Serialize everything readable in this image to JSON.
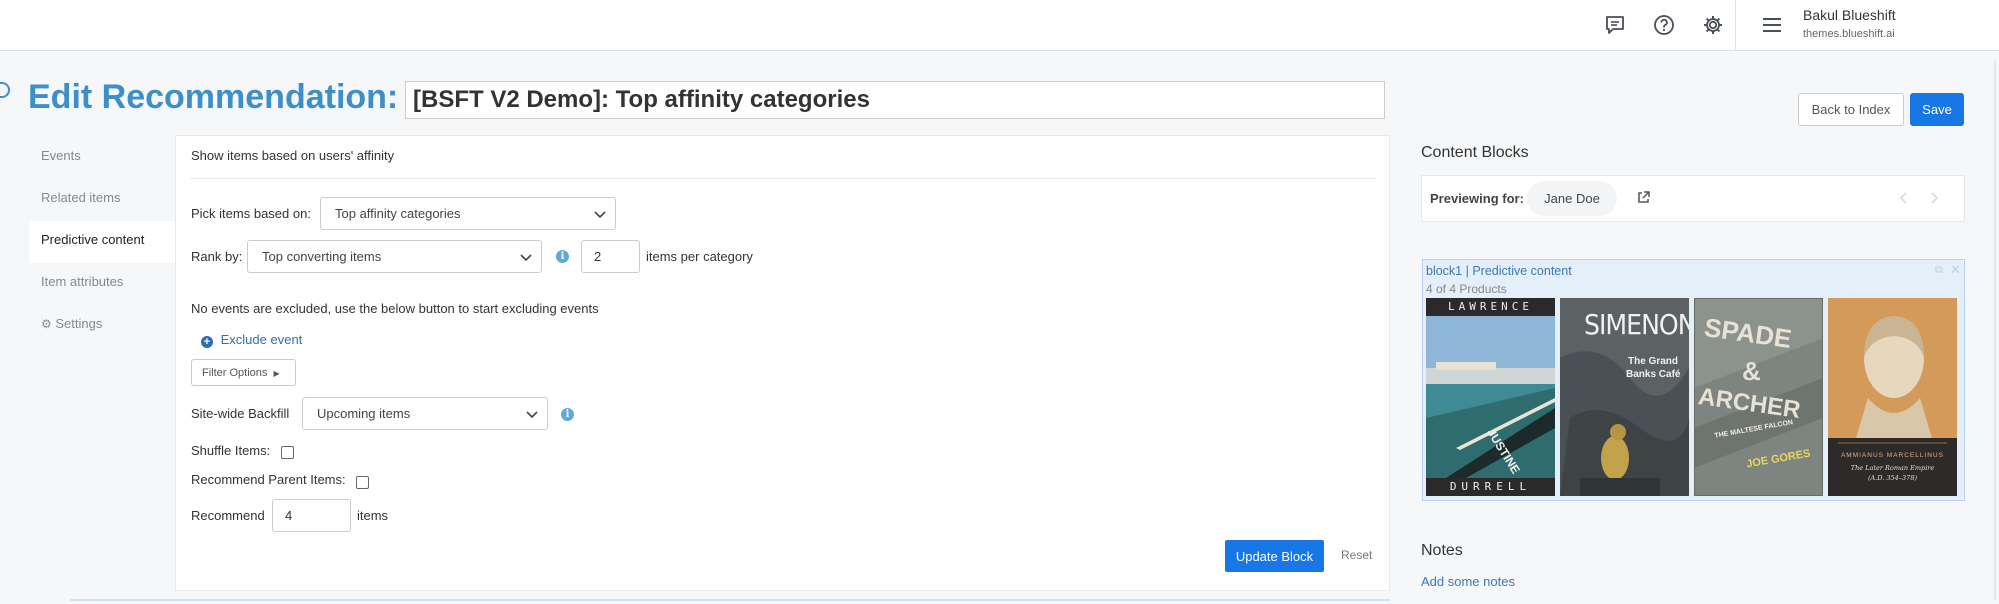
{
  "header": {
    "user_name": "Bakul Blueshift",
    "user_domain": "themes.blueshift.ai",
    "icons": [
      "chat-icon",
      "help-icon",
      "gear-icon",
      "menu-icon"
    ]
  },
  "page": {
    "title": "Edit Recommendation:",
    "recommendation_name": "[BSFT V2 Demo]: Top affinity categories",
    "back_label": "Back to Index",
    "save_label": "Save"
  },
  "sidebar": {
    "items": [
      {
        "label": "Events",
        "active": false
      },
      {
        "label": "Related items",
        "active": false
      },
      {
        "label": "Predictive content",
        "active": true
      },
      {
        "label": "Item attributes",
        "active": false
      },
      {
        "label": "Settings",
        "active": false
      }
    ]
  },
  "form": {
    "heading": "Show items based on users' affinity",
    "pick_label": "Pick items based on:",
    "pick_value": "Top affinity categories",
    "rank_label": "Rank by:",
    "rank_value": "Top converting items",
    "per_category_value": "2",
    "per_category_label": "items per category",
    "excluded_text": "No events are excluded, use the below button to start excluding events",
    "exclude_event_label": "Exclude event",
    "filter_options_label": "Filter Options",
    "backfill_label": "Site-wide Backfill",
    "backfill_value": "Upcoming items",
    "shuffle_label": "Shuffle Items:",
    "shuffle_checked": false,
    "parent_label": "Recommend Parent Items:",
    "parent_checked": false,
    "recommend_label": "Recommend",
    "recommend_value": "4",
    "recommend_unit": "items",
    "update_label": "Update Block",
    "reset_label": "Reset"
  },
  "content_blocks": {
    "title": "Content Blocks",
    "previewing_label": "Previewing for:",
    "preview_user": "Jane Doe",
    "block_header": "block1 | Predictive content",
    "product_count": "4 of 4 Products",
    "books": [
      {
        "top": "LAWRENCE",
        "spine": "JUSTINE",
        "bottom": "DURRELL"
      },
      {
        "author": "SIMENON",
        "title1": "The Grand",
        "title2": "Banks Café"
      },
      {
        "line1": "SPADE",
        "line2": "&",
        "line3": "ARCHER",
        "sub": "THE MALTESE FALCON",
        "author": "JOE GORES"
      },
      {
        "author": "AMMIANUS MARCELLINUS",
        "title": "The Later Roman Empire",
        "dates": "(A.D. 354–378)"
      }
    ]
  },
  "notes": {
    "title": "Notes",
    "add_label": "Add some notes"
  },
  "colors": {
    "title_blue": "#3d8fca",
    "primary_button": "#1877e6",
    "link_blue": "#3a79b5"
  }
}
